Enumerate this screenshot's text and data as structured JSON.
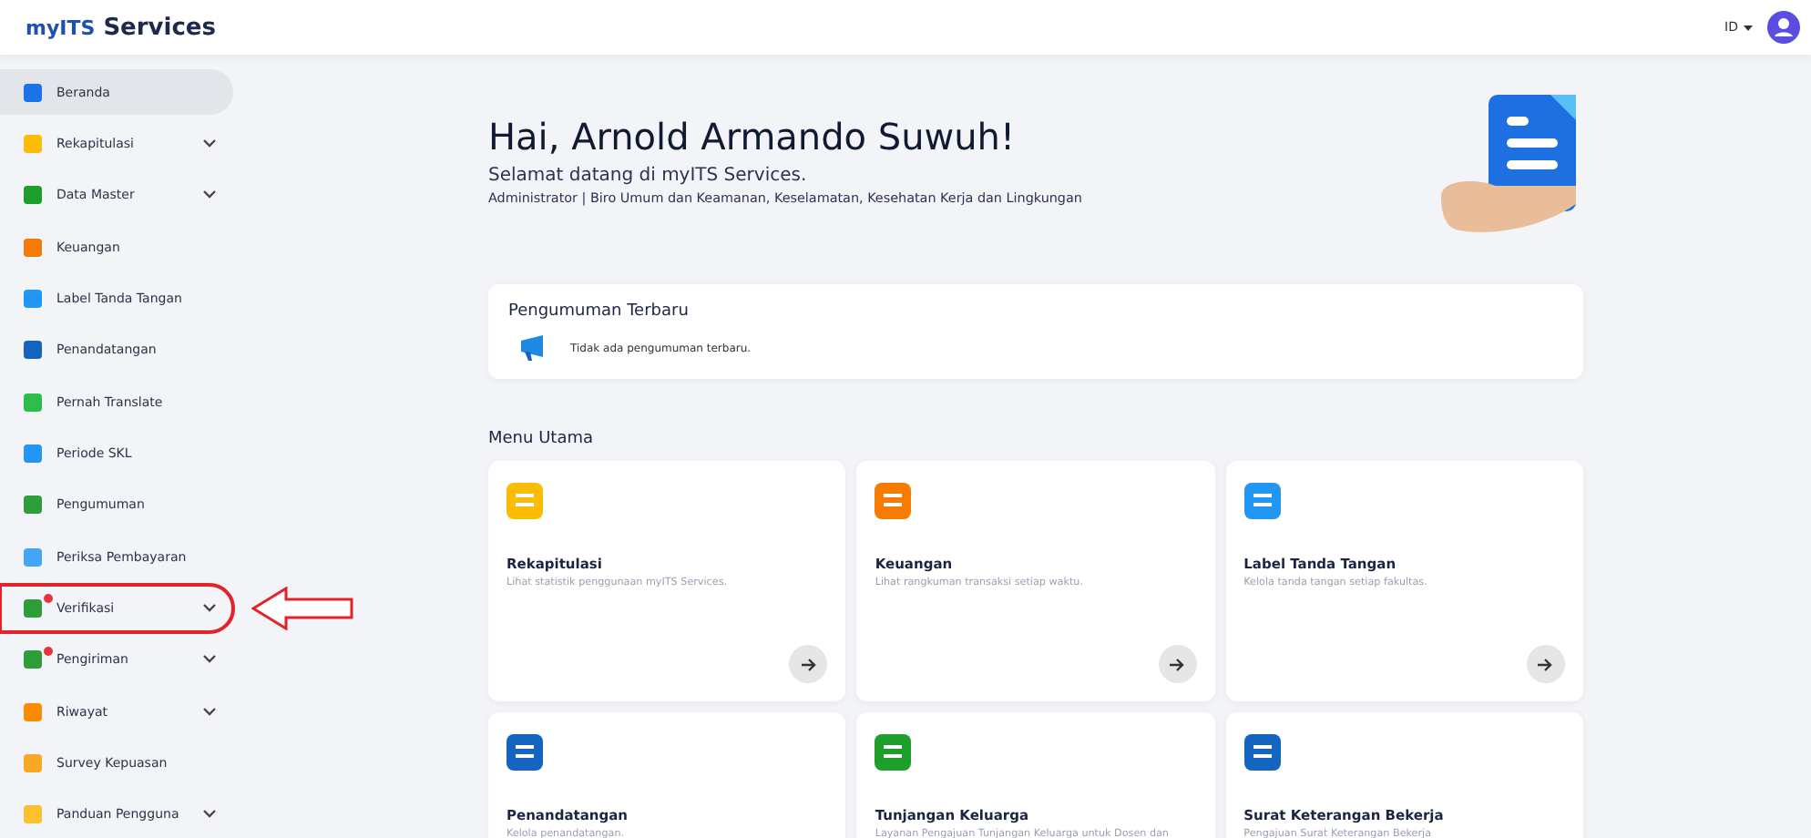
{
  "header": {
    "logo_prefix": "myITS",
    "logo_suffix": "Services",
    "language": "ID"
  },
  "sidebar": {
    "items": [
      {
        "label": "Beranda",
        "selected": true,
        "expandable": false,
        "badge": false,
        "highlighted": false
      },
      {
        "label": "Rekapitulasi",
        "selected": false,
        "expandable": true,
        "badge": false,
        "highlighted": false
      },
      {
        "label": "Data Master",
        "selected": false,
        "expandable": true,
        "badge": false,
        "highlighted": false
      },
      {
        "label": "Keuangan",
        "selected": false,
        "expandable": false,
        "badge": false,
        "highlighted": false
      },
      {
        "label": "Label Tanda Tangan",
        "selected": false,
        "expandable": false,
        "badge": false,
        "highlighted": false
      },
      {
        "label": "Penandatangan",
        "selected": false,
        "expandable": false,
        "badge": false,
        "highlighted": false
      },
      {
        "label": "Pernah Translate",
        "selected": false,
        "expandable": false,
        "badge": false,
        "highlighted": false
      },
      {
        "label": "Periode SKL",
        "selected": false,
        "expandable": false,
        "badge": false,
        "highlighted": false
      },
      {
        "label": "Pengumuman",
        "selected": false,
        "expandable": false,
        "badge": false,
        "highlighted": false
      },
      {
        "label": "Periksa Pembayaran",
        "selected": false,
        "expandable": false,
        "badge": false,
        "highlighted": false
      },
      {
        "label": "Verifikasi",
        "selected": false,
        "expandable": true,
        "badge": true,
        "highlighted": true
      },
      {
        "label": "Pengiriman",
        "selected": false,
        "expandable": true,
        "badge": true,
        "highlighted": false
      },
      {
        "label": "Riwayat",
        "selected": false,
        "expandable": true,
        "badge": false,
        "highlighted": false
      },
      {
        "label": "Survey Kepuasan",
        "selected": false,
        "expandable": false,
        "badge": false,
        "highlighted": false
      },
      {
        "label": "Panduan Pengguna",
        "selected": false,
        "expandable": true,
        "badge": false,
        "highlighted": false
      }
    ]
  },
  "greeting": {
    "title": "Hai, Arnold Armando Suwuh!",
    "subtitle": "Selamat datang di myITS Services.",
    "role": "Administrator | Biro Umum dan Keamanan, Keselamatan, Kesehatan Kerja dan Lingkungan"
  },
  "announcements": {
    "title": "Pengumuman Terbaru",
    "message": "Tidak ada pengumuman terbaru."
  },
  "menu": {
    "title": "Menu Utama",
    "cards": [
      {
        "title": "Rekapitulasi",
        "description": "Lihat statistik penggunaan myITS Services."
      },
      {
        "title": "Keuangan",
        "description": "Lihat rangkuman transaksi setiap waktu."
      },
      {
        "title": "Label Tanda Tangan",
        "description": "Kelola tanda tangan setiap fakultas."
      },
      {
        "title": "Penandatangan",
        "description": "Kelola penandatangan."
      },
      {
        "title": "Tunjangan Keluarga",
        "description": "Layanan Pengajuan Tunjangan Keluarga untuk Dosen dan"
      },
      {
        "title": "Surat Keterangan Bekerja",
        "description": "Pengajuan Surat Keterangan Bekerja"
      }
    ]
  }
}
